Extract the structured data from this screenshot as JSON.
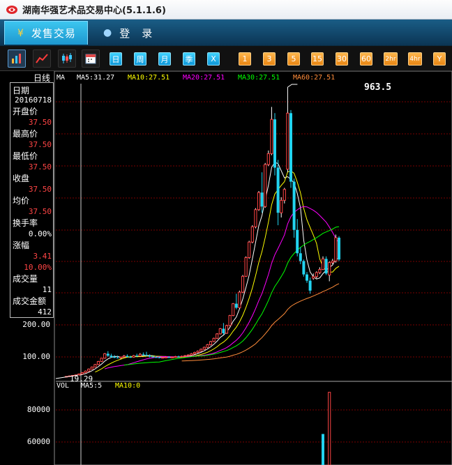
{
  "app": {
    "title": "湖南华强艺术品交易中心(5.1.1.6)"
  },
  "nav": {
    "tabs": [
      {
        "label": "发售交易",
        "icon": "yen-icon"
      },
      {
        "label": "登　录",
        "icon": "user-icon"
      }
    ]
  },
  "toolbar": {
    "period_buttons": [
      "日",
      "周",
      "月",
      "季",
      "X"
    ],
    "minute_buttons": [
      "1",
      "3",
      "5",
      "15",
      "30",
      "60",
      "2hr",
      "4hr",
      "Y"
    ]
  },
  "colors": {
    "up": "#ff4545",
    "down": "#22d3f0",
    "ma5": "#ffffff",
    "ma10": "#ffff00",
    "ma20": "#ff00ff",
    "ma30": "#00ff00",
    "ma60": "#ff8c3a",
    "grid": "#7a0000"
  },
  "info_panel": {
    "items": [
      {
        "label": "日期",
        "value": "20160718",
        "tone": "white"
      },
      {
        "label": "开盘价",
        "value": "37.50",
        "tone": "red"
      },
      {
        "label": "最高价",
        "value": "37.50",
        "tone": "red"
      },
      {
        "label": "最低价",
        "value": "37.50",
        "tone": "red"
      },
      {
        "label": "收盘",
        "value": "37.50",
        "tone": "red"
      },
      {
        "label": "均价",
        "value": "37.50",
        "tone": "red"
      },
      {
        "label": "换手率",
        "value": "0.00%",
        "tone": "white"
      },
      {
        "label": "涨幅",
        "value": "3.41",
        "tone": "red"
      },
      {
        "label": "",
        "value": "10.00%",
        "tone": "red"
      },
      {
        "label": "成交量",
        "value": "11",
        "tone": "white"
      },
      {
        "label": "成交金额",
        "value": "412",
        "tone": "white"
      }
    ]
  },
  "chart_data": [
    {
      "type": "candlestick",
      "title": "日线",
      "indicator": "MA",
      "ma_legend": [
        {
          "text": "MA5:31.27",
          "color": "#ffffff"
        },
        {
          "text": "MA10:27.51",
          "color": "#ffff00"
        },
        {
          "text": "MA20:27.51",
          "color": "#ff00ff"
        },
        {
          "text": "MA30:27.51",
          "color": "#00ff00"
        },
        {
          "text": "MA60:27.51",
          "color": "#ff8c3a"
        }
      ],
      "y_ticks": [
        {
          "value": 200,
          "label": "200.00"
        },
        {
          "value": 100,
          "label": "100.00"
        }
      ],
      "ylim": [
        20,
        1000
      ],
      "annotations": {
        "max_label": "963.5",
        "min_label": "19.29"
      },
      "candles": [
        {
          "o": 22,
          "h": 24,
          "l": 20,
          "c": 23
        },
        {
          "o": 23,
          "h": 26,
          "l": 22,
          "c": 25
        },
        {
          "o": 25,
          "h": 28,
          "l": 24,
          "c": 27
        },
        {
          "o": 27,
          "h": 30,
          "l": 26,
          "c": 29
        },
        {
          "o": 29,
          "h": 34,
          "l": 28,
          "c": 33
        },
        {
          "o": 33,
          "h": 40,
          "l": 32,
          "c": 38
        },
        {
          "o": 38,
          "h": 46,
          "l": 37,
          "c": 44
        },
        {
          "o": 44,
          "h": 54,
          "l": 43,
          "c": 52
        },
        {
          "o": 52,
          "h": 62,
          "l": 50,
          "c": 60
        },
        {
          "o": 60,
          "h": 72,
          "l": 58,
          "c": 70
        },
        {
          "o": 70,
          "h": 84,
          "l": 68,
          "c": 82
        },
        {
          "o": 82,
          "h": 96,
          "l": 80,
          "c": 95
        },
        {
          "o": 95,
          "h": 112,
          "l": 93,
          "c": 110
        },
        {
          "o": 110,
          "h": 118,
          "l": 100,
          "c": 104
        },
        {
          "o": 104,
          "h": 110,
          "l": 96,
          "c": 100
        },
        {
          "o": 100,
          "h": 106,
          "l": 95,
          "c": 98
        },
        {
          "o": 98,
          "h": 104,
          "l": 94,
          "c": 96
        },
        {
          "o": 96,
          "h": 101,
          "l": 92,
          "c": 100
        },
        {
          "o": 100,
          "h": 106,
          "l": 98,
          "c": 103
        },
        {
          "o": 103,
          "h": 108,
          "l": 98,
          "c": 100
        },
        {
          "o": 100,
          "h": 104,
          "l": 96,
          "c": 99
        },
        {
          "o": 99,
          "h": 106,
          "l": 97,
          "c": 104
        },
        {
          "o": 104,
          "h": 110,
          "l": 100,
          "c": 103
        },
        {
          "o": 103,
          "h": 112,
          "l": 101,
          "c": 108
        },
        {
          "o": 108,
          "h": 114,
          "l": 104,
          "c": 106
        },
        {
          "o": 106,
          "h": 116,
          "l": 102,
          "c": 104
        },
        {
          "o": 104,
          "h": 108,
          "l": 98,
          "c": 101
        },
        {
          "o": 101,
          "h": 105,
          "l": 97,
          "c": 99
        },
        {
          "o": 99,
          "h": 103,
          "l": 96,
          "c": 98
        },
        {
          "o": 98,
          "h": 101,
          "l": 95,
          "c": 97
        },
        {
          "o": 97,
          "h": 100,
          "l": 95,
          "c": 98
        },
        {
          "o": 98,
          "h": 101,
          "l": 96,
          "c": 99
        },
        {
          "o": 99,
          "h": 102,
          "l": 97,
          "c": 98
        },
        {
          "o": 98,
          "h": 101,
          "l": 96,
          "c": 99
        },
        {
          "o": 99,
          "h": 103,
          "l": 97,
          "c": 101
        },
        {
          "o": 101,
          "h": 104,
          "l": 98,
          "c": 100
        },
        {
          "o": 100,
          "h": 104,
          "l": 98,
          "c": 102
        },
        {
          "o": 102,
          "h": 106,
          "l": 100,
          "c": 104
        },
        {
          "o": 104,
          "h": 108,
          "l": 102,
          "c": 106
        },
        {
          "o": 106,
          "h": 112,
          "l": 104,
          "c": 110
        },
        {
          "o": 110,
          "h": 116,
          "l": 108,
          "c": 114
        },
        {
          "o": 114,
          "h": 120,
          "l": 112,
          "c": 118
        },
        {
          "o": 118,
          "h": 126,
          "l": 116,
          "c": 124
        },
        {
          "o": 124,
          "h": 132,
          "l": 122,
          "c": 130
        },
        {
          "o": 130,
          "h": 140,
          "l": 128,
          "c": 138
        },
        {
          "o": 138,
          "h": 150,
          "l": 136,
          "c": 148
        },
        {
          "o": 148,
          "h": 160,
          "l": 146,
          "c": 158
        },
        {
          "o": 158,
          "h": 174,
          "l": 156,
          "c": 172
        },
        {
          "o": 172,
          "h": 190,
          "l": 170,
          "c": 188
        },
        {
          "o": 188,
          "h": 206,
          "l": 170,
          "c": 174
        },
        {
          "o": 174,
          "h": 200,
          "l": 172,
          "c": 198
        },
        {
          "o": 198,
          "h": 232,
          "l": 196,
          "c": 230
        },
        {
          "o": 230,
          "h": 270,
          "l": 228,
          "c": 268
        },
        {
          "o": 268,
          "h": 300,
          "l": 250,
          "c": 255
        },
        {
          "o": 255,
          "h": 310,
          "l": 252,
          "c": 305
        },
        {
          "o": 305,
          "h": 360,
          "l": 302,
          "c": 356
        },
        {
          "o": 356,
          "h": 420,
          "l": 354,
          "c": 416
        },
        {
          "o": 416,
          "h": 470,
          "l": 412,
          "c": 466
        },
        {
          "o": 466,
          "h": 520,
          "l": 462,
          "c": 515
        },
        {
          "o": 515,
          "h": 575,
          "l": 510,
          "c": 570
        },
        {
          "o": 570,
          "h": 630,
          "l": 566,
          "c": 625
        },
        {
          "o": 625,
          "h": 690,
          "l": 560,
          "c": 580
        },
        {
          "o": 580,
          "h": 720,
          "l": 576,
          "c": 715
        },
        {
          "o": 715,
          "h": 760,
          "l": 710,
          "c": 750
        },
        {
          "o": 750,
          "h": 900,
          "l": 745,
          "c": 860
        },
        {
          "o": 860,
          "h": 880,
          "l": 680,
          "c": 705
        },
        {
          "o": 705,
          "h": 730,
          "l": 520,
          "c": 560
        },
        {
          "o": 560,
          "h": 610,
          "l": 545,
          "c": 600
        },
        {
          "o": 600,
          "h": 640,
          "l": 590,
          "c": 635
        },
        {
          "o": 700,
          "h": 963.5,
          "l": 690,
          "c": 880
        },
        {
          "o": 880,
          "h": 890,
          "l": 640,
          "c": 660
        },
        {
          "o": 660,
          "h": 670,
          "l": 480,
          "c": 505
        },
        {
          "o": 505,
          "h": 540,
          "l": 420,
          "c": 430
        },
        {
          "o": 430,
          "h": 450,
          "l": 395,
          "c": 405
        },
        {
          "o": 405,
          "h": 410,
          "l": 355,
          "c": 362
        },
        {
          "o": 362,
          "h": 370,
          "l": 335,
          "c": 342
        },
        {
          "o": 342,
          "h": 352,
          "l": 300,
          "c": 310
        },
        {
          "o": 350,
          "h": 365,
          "l": 345,
          "c": 355
        },
        {
          "o": 355,
          "h": 372,
          "l": 350,
          "c": 368
        },
        {
          "o": 368,
          "h": 385,
          "l": 363,
          "c": 378
        },
        {
          "o": 378,
          "h": 420,
          "l": 376,
          "c": 412
        },
        {
          "o": 412,
          "h": 420,
          "l": 360,
          "c": 365
        },
        {
          "o": 360,
          "h": 404,
          "l": 340,
          "c": 400
        },
        {
          "o": 400,
          "h": 412,
          "l": 395,
          "c": 405
        },
        {
          "o": 405,
          "h": 490,
          "l": 400,
          "c": 480
        },
        {
          "o": 480,
          "h": 485,
          "l": 405,
          "c": 410
        }
      ]
    },
    {
      "type": "bar",
      "title": "VOL",
      "legend": [
        {
          "text": "MA5:5",
          "color": "#ffffff"
        },
        {
          "text": "MA10:0",
          "color": "#ffff00"
        }
      ],
      "y_ticks": [
        {
          "value": 80000,
          "label": "80000"
        },
        {
          "value": 60000,
          "label": "60000"
        }
      ],
      "ylim": [
        40000,
        90000
      ],
      "bars": [
        {
          "index": 80,
          "value": 65000,
          "tone": "down"
        },
        {
          "index": 82,
          "value": 91000,
          "tone": "up"
        }
      ]
    }
  ]
}
